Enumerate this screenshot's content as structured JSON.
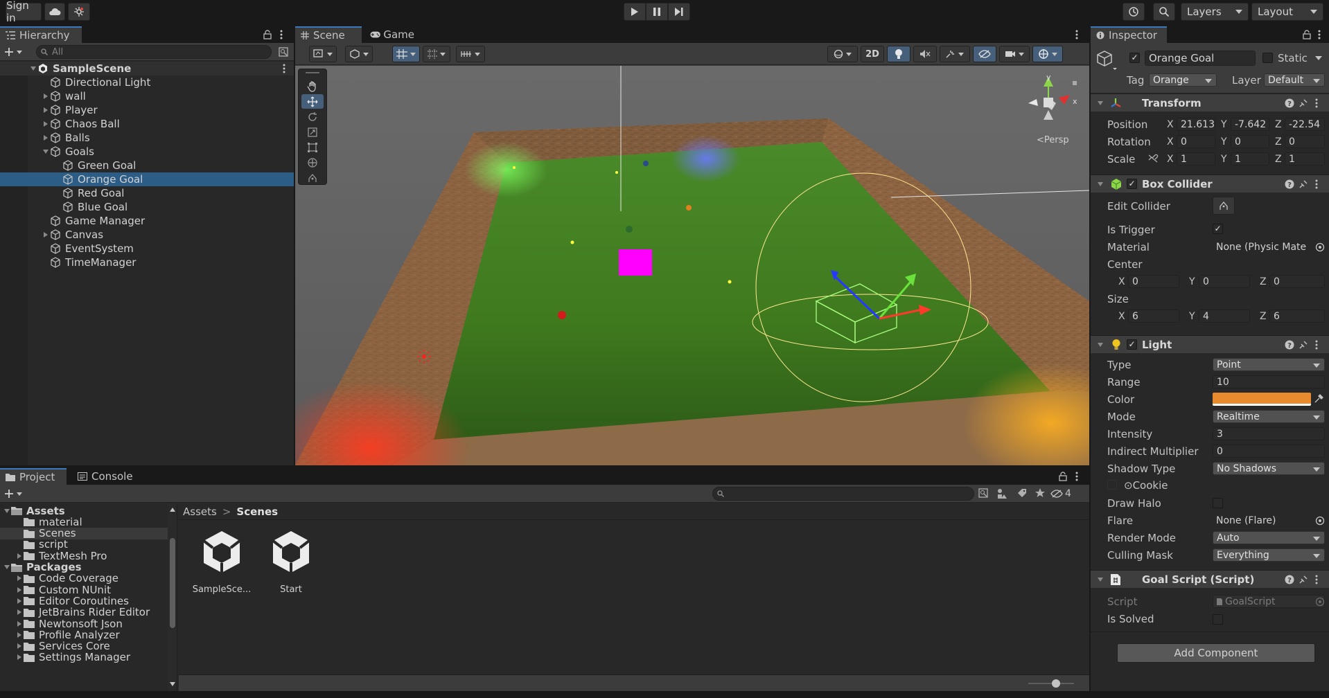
{
  "toolbar": {
    "sign_in": "Sign in",
    "layers": "Layers",
    "layout": "Layout"
  },
  "hierarchy": {
    "tab": "Hierarchy",
    "search_placeholder": "All",
    "scene": "SampleScene",
    "items": [
      {
        "label": "Directional Light",
        "indent": 1,
        "fold": "none"
      },
      {
        "label": "wall",
        "indent": 1,
        "fold": "right"
      },
      {
        "label": "Player",
        "indent": 1,
        "fold": "right"
      },
      {
        "label": "Chaos Ball",
        "indent": 1,
        "fold": "right"
      },
      {
        "label": "Balls",
        "indent": 1,
        "fold": "right"
      },
      {
        "label": "Goals",
        "indent": 1,
        "fold": "down"
      },
      {
        "label": "Green Goal",
        "indent": 2,
        "fold": "none"
      },
      {
        "label": "Orange Goal",
        "indent": 2,
        "fold": "none",
        "selected": true
      },
      {
        "label": "Red Goal",
        "indent": 2,
        "fold": "none"
      },
      {
        "label": "Blue Goal",
        "indent": 2,
        "fold": "none"
      },
      {
        "label": "Game Manager",
        "indent": 1,
        "fold": "none"
      },
      {
        "label": "Canvas",
        "indent": 1,
        "fold": "right"
      },
      {
        "label": "EventSystem",
        "indent": 1,
        "fold": "none"
      },
      {
        "label": "TimeManager",
        "indent": 1,
        "fold": "none"
      }
    ]
  },
  "scene": {
    "tab_scene": "Scene",
    "tab_game": "Game",
    "btn_2d": "2D",
    "gizmo_y": "y",
    "gizmo_x": "x",
    "persp": "Persp"
  },
  "inspector": {
    "tab": "Inspector",
    "object_name": "Orange Goal",
    "static_label": "Static",
    "tag_label": "Tag",
    "tag_value": "Orange",
    "layer_label": "Layer",
    "layer_value": "Default",
    "transform": {
      "title": "Transform",
      "position_label": "Position",
      "rotation_label": "Rotation",
      "scale_label": "Scale",
      "position": {
        "x": "21.613",
        "y": "-7.642",
        "z": "-22.54"
      },
      "rotation": {
        "x": "0",
        "y": "0",
        "z": "0"
      },
      "scale": {
        "x": "1",
        "y": "1",
        "z": "1"
      }
    },
    "box_collider": {
      "title": "Box Collider",
      "edit_collider": "Edit Collider",
      "is_trigger": "Is Trigger",
      "material_label": "Material",
      "material_value": "None (Physic Mate",
      "center_label": "Center",
      "center": {
        "x": "0",
        "y": "0",
        "z": "0"
      },
      "size_label": "Size",
      "size": {
        "x": "6",
        "y": "4",
        "z": "6"
      }
    },
    "light": {
      "title": "Light",
      "type_label": "Type",
      "type_value": "Point",
      "range_label": "Range",
      "range_value": "10",
      "color_label": "Color",
      "color_value": "#e88a2e",
      "mode_label": "Mode",
      "mode_value": "Realtime",
      "intensity_label": "Intensity",
      "intensity_value": "3",
      "indirect_label": "Indirect Multiplier",
      "indirect_value": "0",
      "shadow_label": "Shadow Type",
      "shadow_value": "No Shadows",
      "cookie_label": "Cookie",
      "halo_label": "Draw Halo",
      "flare_label": "Flare",
      "flare_value": "None (Flare)",
      "render_label": "Render Mode",
      "render_value": "Auto",
      "culling_label": "Culling Mask",
      "culling_value": "Everything"
    },
    "goal_script": {
      "title": "Goal Script (Script)",
      "script_label": "Script",
      "script_value": "GoalScript",
      "solved_label": "Is Solved"
    },
    "add_component": "Add Component"
  },
  "project": {
    "tab_project": "Project",
    "tab_console": "Console",
    "hidden_count": "4",
    "breadcrumb_root": "Assets",
    "breadcrumb_current": "Scenes",
    "tree": [
      {
        "label": "Assets",
        "level": 0,
        "fold": "down",
        "bold": true
      },
      {
        "label": "material",
        "level": 1,
        "fold": "none"
      },
      {
        "label": "Scenes",
        "level": 1,
        "fold": "none",
        "selected": true
      },
      {
        "label": "script",
        "level": 1,
        "fold": "none"
      },
      {
        "label": "TextMesh Pro",
        "level": 1,
        "fold": "right"
      },
      {
        "label": "Packages",
        "level": 0,
        "fold": "down",
        "bold": true
      },
      {
        "label": "Code Coverage",
        "level": 1,
        "fold": "right"
      },
      {
        "label": "Custom NUnit",
        "level": 1,
        "fold": "right"
      },
      {
        "label": "Editor Coroutines",
        "level": 1,
        "fold": "right"
      },
      {
        "label": "JetBrains Rider Editor",
        "level": 1,
        "fold": "right"
      },
      {
        "label": "Newtonsoft Json",
        "level": 1,
        "fold": "right"
      },
      {
        "label": "Profile Analyzer",
        "level": 1,
        "fold": "right"
      },
      {
        "label": "Services Core",
        "level": 1,
        "fold": "right"
      },
      {
        "label": "Settings Manager",
        "level": 1,
        "fold": "right"
      }
    ],
    "assets": [
      {
        "label": "SampleSce..."
      },
      {
        "label": "Start"
      }
    ]
  }
}
